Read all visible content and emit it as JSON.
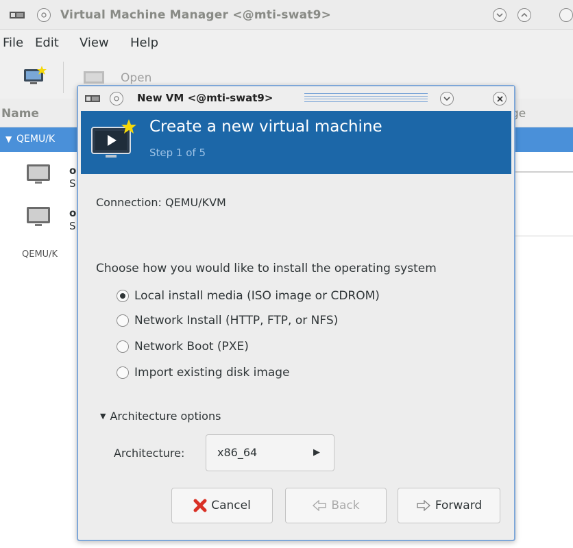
{
  "main_window": {
    "title": "Virtual Machine Manager <@mti-swat9>",
    "menu": [
      "File",
      "Edit",
      "View",
      "Help"
    ],
    "toolbar": {
      "open_label": "Open"
    },
    "columns": {
      "name": "Name",
      "usage_partial": "ge"
    },
    "connection_row": "QEMU/K",
    "vms": [
      {
        "name_partial": "o",
        "status_partial": "S"
      },
      {
        "name_partial": "o",
        "status_partial": "S"
      }
    ],
    "ghost_connection": "QEMU/K"
  },
  "dialog": {
    "title": "New VM <@mti-swat9>",
    "headline": "Create a new virtual machine",
    "step": "Step 1 of 5",
    "connection": "Connection: QEMU/KVM",
    "prompt": "Choose how you would like to install the operating system",
    "options": [
      {
        "label": "Local install media (ISO image or CDROM)",
        "selected": true
      },
      {
        "label": "Network Install (HTTP, FTP, or NFS)",
        "selected": false
      },
      {
        "label": "Network Boot (PXE)",
        "selected": false
      },
      {
        "label": "Import existing disk image",
        "selected": false
      }
    ],
    "architecture": {
      "expander": "Architecture options",
      "label": "Architecture:",
      "value": "x86_64"
    },
    "buttons": {
      "cancel": "Cancel",
      "back": "Back",
      "forward": "Forward"
    }
  },
  "colors": {
    "selection": "#4a90d9",
    "banner": "#1c67a8",
    "dialog_border": "#7ea7d8",
    "cancel_icon": "#d93025"
  }
}
